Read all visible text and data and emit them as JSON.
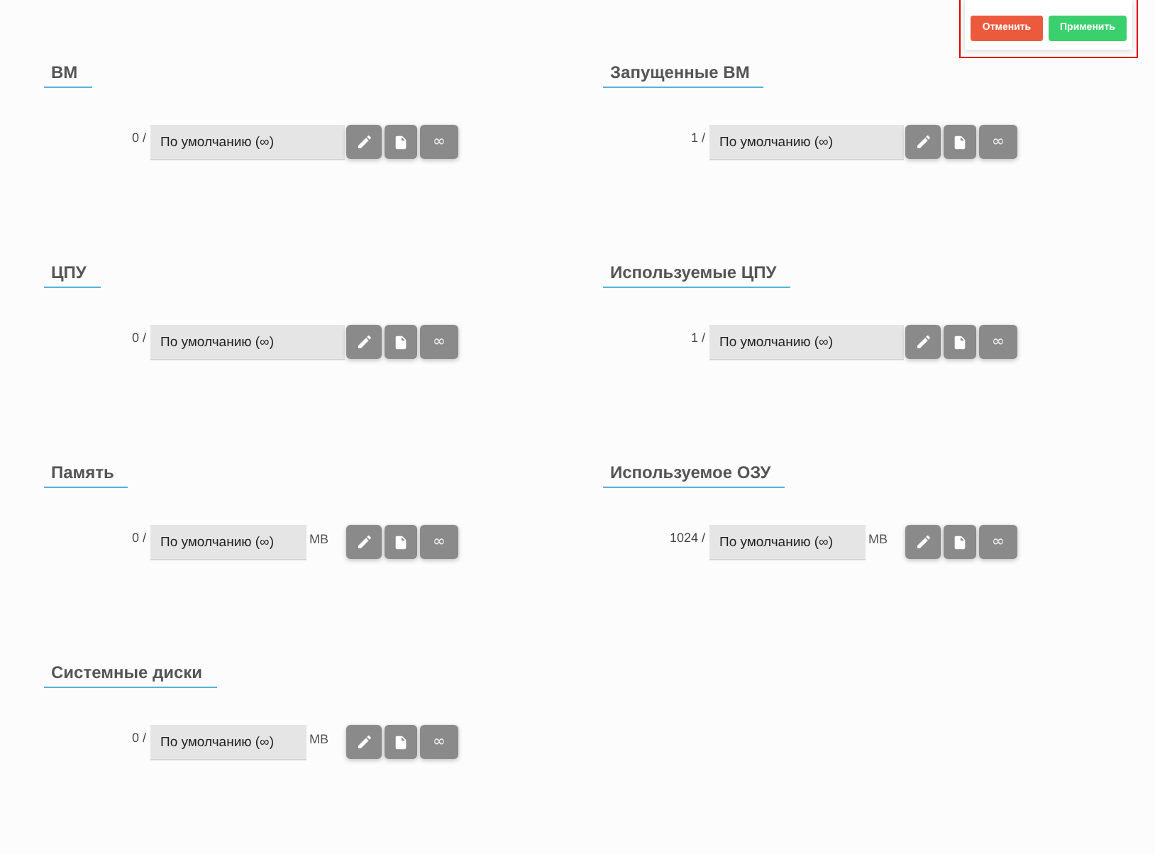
{
  "actions": {
    "buttons": [
      {
        "label": "Отменить",
        "kind": "cancel"
      },
      {
        "label": "Применить",
        "kind": "apply"
      }
    ]
  },
  "quotas": [
    {
      "title": "ВМ",
      "count": "0 /",
      "value": "По умолчанию (∞)",
      "unlimited_label": "∞"
    },
    {
      "title": "Запущенные ВМ",
      "count": "1 /",
      "value": "По умолчанию (∞)",
      "unlimited_label": "∞"
    },
    {
      "title": "ЦПУ",
      "count": "0 /",
      "value": "По умолчанию (∞)",
      "unlimited_label": "∞"
    },
    {
      "title": "Используемые ЦПУ",
      "count": "1 /",
      "value": "По умолчанию (∞)",
      "unlimited_label": "∞"
    },
    {
      "title": "Память",
      "count": "0 /",
      "value": "По умолчанию (∞)",
      "unit": "MB",
      "unlimited_label": "∞"
    },
    {
      "title": "Используемое ОЗУ",
      "count": "1024 /",
      "value": "По умолчанию (∞)",
      "unit": "MB",
      "unlimited_label": "∞"
    },
    {
      "title": "Системные диски",
      "count": "0 /",
      "value": "По умолчанию (∞)",
      "unit": "MB",
      "unlimited_label": "∞"
    }
  ]
}
